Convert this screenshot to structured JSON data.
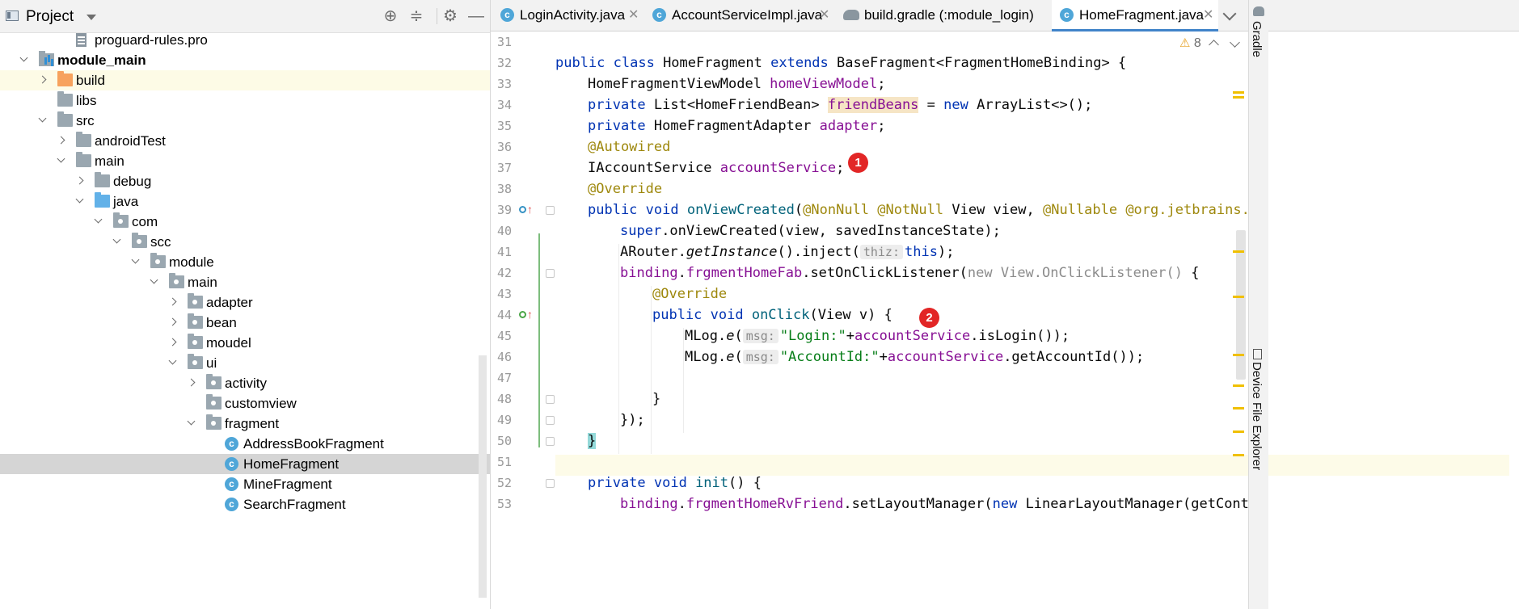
{
  "project_panel": {
    "title": "Project",
    "tree": [
      {
        "label": "proguard-rules.pro",
        "icon": "file-icon",
        "depth": 3,
        "arrow": "none"
      },
      {
        "label": "module_main",
        "icon": "module-folder-icon",
        "depth": 1,
        "arrow": "open",
        "bold": true
      },
      {
        "label": "build",
        "icon": "orange-folder-icon",
        "depth": 2,
        "arrow": "closed",
        "highlight": "yellow"
      },
      {
        "label": "libs",
        "icon": "folder-icon",
        "depth": 2,
        "arrow": "none"
      },
      {
        "label": "src",
        "icon": "folder-icon",
        "depth": 2,
        "arrow": "open"
      },
      {
        "label": "androidTest",
        "icon": "folder-icon",
        "depth": 3,
        "arrow": "closed"
      },
      {
        "label": "main",
        "icon": "folder-icon",
        "depth": 3,
        "arrow": "open"
      },
      {
        "label": "debug",
        "icon": "folder-icon",
        "depth": 4,
        "arrow": "closed"
      },
      {
        "label": "java",
        "icon": "blue-folder-icon",
        "depth": 4,
        "arrow": "open"
      },
      {
        "label": "com",
        "icon": "package-icon",
        "depth": 5,
        "arrow": "open"
      },
      {
        "label": "scc",
        "icon": "package-icon",
        "depth": 6,
        "arrow": "open"
      },
      {
        "label": "module",
        "icon": "package-icon",
        "depth": 7,
        "arrow": "open"
      },
      {
        "label": "main",
        "icon": "package-icon",
        "depth": 8,
        "arrow": "open"
      },
      {
        "label": "adapter",
        "icon": "package-icon",
        "depth": 9,
        "arrow": "closed"
      },
      {
        "label": "bean",
        "icon": "package-icon",
        "depth": 9,
        "arrow": "closed"
      },
      {
        "label": "moudel",
        "icon": "package-icon",
        "depth": 9,
        "arrow": "closed"
      },
      {
        "label": "ui",
        "icon": "package-icon",
        "depth": 9,
        "arrow": "open"
      },
      {
        "label": "activity",
        "icon": "package-icon",
        "depth": 10,
        "arrow": "closed"
      },
      {
        "label": "customview",
        "icon": "package-icon",
        "depth": 10,
        "arrow": "none"
      },
      {
        "label": "fragment",
        "icon": "package-icon",
        "depth": 10,
        "arrow": "open"
      },
      {
        "label": "AddressBookFragment",
        "icon": "class-icon",
        "depth": 11,
        "arrow": "none"
      },
      {
        "label": "HomeFragment",
        "icon": "class-icon",
        "depth": 11,
        "arrow": "none",
        "highlight": "gray"
      },
      {
        "label": "MineFragment",
        "icon": "class-icon",
        "depth": 11,
        "arrow": "none"
      },
      {
        "label": "SearchFragment",
        "icon": "class-icon",
        "depth": 11,
        "arrow": "none"
      }
    ]
  },
  "tabs": [
    {
      "label": "LoginActivity.java",
      "icon": "class-icon"
    },
    {
      "label": "AccountServiceImpl.java",
      "icon": "class-icon"
    },
    {
      "label": "build.gradle (:module_login)",
      "icon": "gradle-icon"
    },
    {
      "label": "HomeFragment.java",
      "icon": "class-icon",
      "active": true
    }
  ],
  "editor": {
    "warning_count": "8",
    "line_numbers": [
      "31",
      "32",
      "33",
      "34",
      "35",
      "36",
      "37",
      "38",
      "39",
      "40",
      "41",
      "42",
      "43",
      "44",
      "45",
      "46",
      "47",
      "48",
      "49",
      "50",
      "51",
      "52",
      "53"
    ],
    "code": {
      "l32": {
        "a": "public class ",
        "b": "HomeFragment ",
        "c": "extends ",
        "d": "BaseFragment<FragmentHomeBinding> {"
      },
      "l33": {
        "a": "HomeFragmentViewModel ",
        "b": "homeViewModel",
        "c": ";"
      },
      "l34": {
        "a": "private ",
        "b": "List<HomeFriendBean> ",
        "c": "friendBeans",
        "d": " = ",
        "e": "new ",
        "f": "ArrayList<>();"
      },
      "l35": {
        "a": "private ",
        "b": "HomeFragmentAdapter ",
        "c": "adapter",
        "d": ";"
      },
      "l36": {
        "a": "@Autowired"
      },
      "l37": {
        "a": "IAccountService ",
        "b": "accountService",
        "c": ";"
      },
      "l38": {
        "a": "@Override"
      },
      "l39": {
        "a": "public void ",
        "b": "onViewCreated",
        "c": "(",
        "d": "@NonNull @NotNull ",
        "e": "View view, ",
        "f": "@Nullable @org.jetbrains.an"
      },
      "l40": {
        "a": "super",
        "b": ".onViewCreated(view, savedInstanceState);"
      },
      "l41": {
        "a": "ARouter.",
        "b": "getInstance",
        "c": "().inject(",
        "hint": "thiz:",
        "d": "this",
        "e": ");"
      },
      "l42": {
        "a": "binding",
        "b": ".",
        "c": "frgmentHomeFab",
        "d": ".setOnClickListener(",
        "e": "new View.OnClickListener()",
        "f": " {"
      },
      "l43": {
        "a": "@Override"
      },
      "l44": {
        "a": "public void ",
        "b": "onClick",
        "c": "(View v) {"
      },
      "l45": {
        "a": "MLog.",
        "b": "e",
        "c": "(",
        "hint": "msg:",
        "d": "\"Login:\"",
        "e": "+",
        "f": "accountService",
        "g": ".isLogin());"
      },
      "l46": {
        "a": "MLog.",
        "b": "e",
        "c": "(",
        "hint": "msg:",
        "d": "\"AccountId:\"",
        "e": "+",
        "f": "accountService",
        "g": ".getAccountId());"
      },
      "l48": {
        "a": "}"
      },
      "l49": {
        "a": "});"
      },
      "l50": {
        "a": "}"
      },
      "l52": {
        "a": "private void ",
        "b": "init",
        "c": "() {"
      },
      "l53": {
        "a": "binding",
        "b": ".",
        "c": "frgmentHomeRvFriend",
        "d": ".setLayoutManager(",
        "e": "new ",
        "f": "LinearLayoutManager(getContex"
      }
    },
    "badges": [
      "1",
      "2"
    ]
  },
  "right_strip": {
    "gradle_label": "Gradle",
    "device_explorer_label": "Device File Explorer"
  },
  "colors": {
    "keyword": "#0033b3",
    "field": "#871094",
    "annotation": "#9e880d",
    "string": "#067d17",
    "method": "#00627a",
    "badge": "#e22626",
    "active_tab_underline": "#4083c9"
  }
}
